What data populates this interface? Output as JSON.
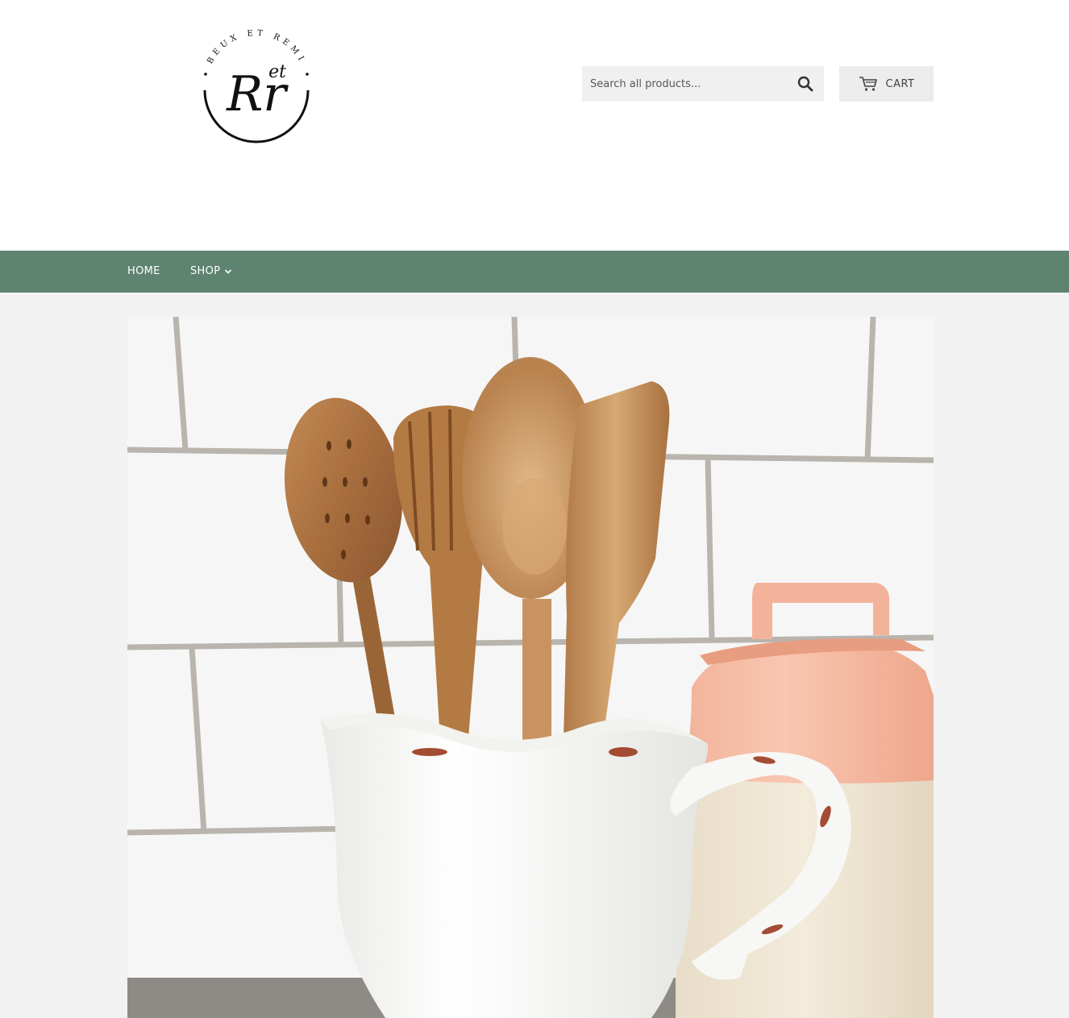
{
  "header": {
    "logo": {
      "text_top": "BEUX ET REMI",
      "monogram": "Rr",
      "monogram_small": "et"
    },
    "search": {
      "placeholder": "Search all products...",
      "icon": "search-icon"
    },
    "cart": {
      "label": "CART",
      "icon": "cart-icon"
    }
  },
  "nav": {
    "items": [
      {
        "label": "HOME"
      },
      {
        "label": "SHOP",
        "icon": "chevron-down-icon"
      }
    ]
  },
  "hero": {
    "image": "wooden-utensils-in-white-ceramic-pitcher-with-pink-canister"
  },
  "colors": {
    "nav_background": "#5f8371",
    "page_background": "#f2f2f2",
    "header_background": "#ffffff",
    "search_background": "#f0f0f0",
    "cart_background": "#ececec"
  }
}
